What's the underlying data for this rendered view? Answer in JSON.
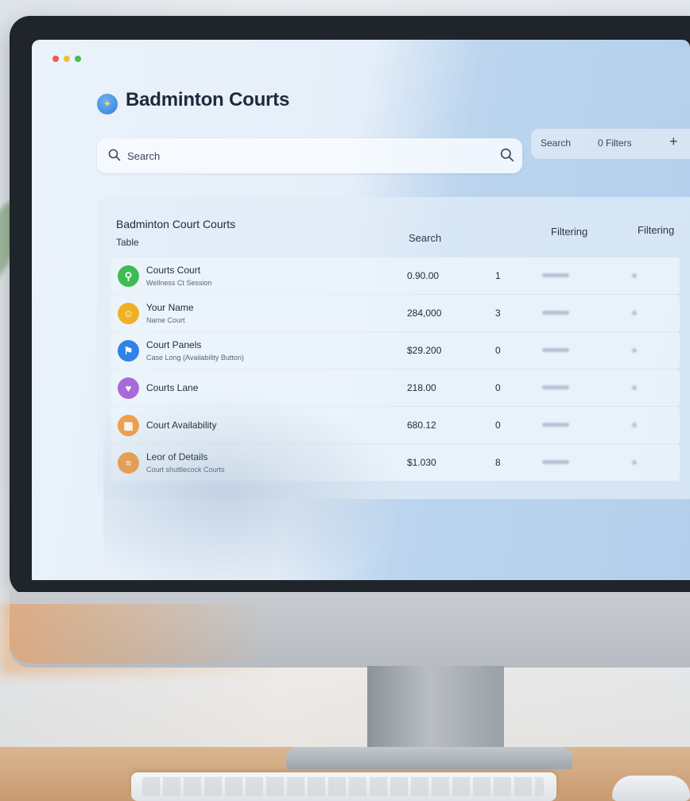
{
  "app": {
    "title": "Badminton Courts",
    "colors": {
      "accent": "#2f7fd6",
      "screen_bg": "#e6eff9"
    }
  },
  "search": {
    "value": "Search",
    "placeholder": "Search",
    "lead_icon": "search-icon",
    "trail_icon": "search-icon"
  },
  "toolbar": {
    "search_label": "Search",
    "filters_label": "0 Filters",
    "add_label": "+"
  },
  "table": {
    "title": "Badminton Court Courts",
    "subtitle": "Table",
    "columns": [
      "Search",
      "Filtering",
      "Filtering"
    ],
    "rows": [
      {
        "name": "Courts Court",
        "desc": "Wellness Ct Session",
        "value": "0.90.00",
        "count": "1",
        "icon": "badminton-player-icon",
        "color": "#3dbb55",
        "glyph": "⚲"
      },
      {
        "name": "Your Name",
        "desc": "Name Court",
        "value": "284,000",
        "count": "3",
        "icon": "person-icon",
        "color": "#f0b025",
        "glyph": "☺"
      },
      {
        "name": "Court Panels",
        "desc": "Case Long (Availability Button)",
        "value": "$29.200",
        "count": "0",
        "icon": "pin-icon",
        "color": "#2f82e6",
        "glyph": "⚑"
      },
      {
        "name": "Courts Lane",
        "desc": "",
        "value": "218.00",
        "count": "0",
        "icon": "heart-icon",
        "color": "#a86ad9",
        "glyph": "♥"
      },
      {
        "name": "Court Availability",
        "desc": "",
        "value": "680.12",
        "count": "0",
        "icon": "calendar-icon",
        "color": "#f2a04a",
        "glyph": "▦"
      },
      {
        "name": "Leor of Details",
        "desc": "Court shuttlecock Courts",
        "value": "$1.030",
        "count": "8",
        "icon": "stats-icon",
        "color": "#f2a04a",
        "glyph": "≡"
      }
    ]
  }
}
